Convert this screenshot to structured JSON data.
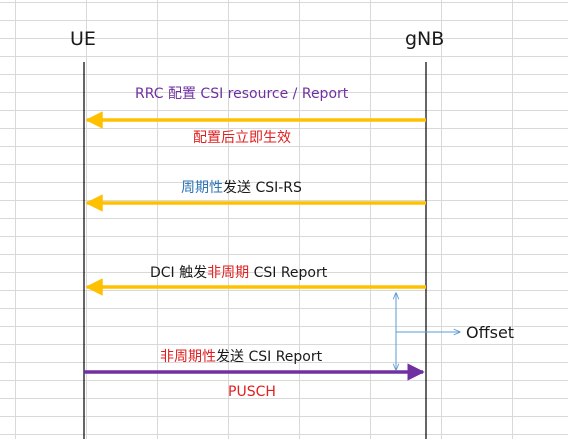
{
  "participants": {
    "left": "UE",
    "right": "gNB"
  },
  "colors": {
    "arrow_gold": "#FFC000",
    "arrow_purple": "#7030A0",
    "timing_blue": "#5B9BD5",
    "text_purple": "#7030A0",
    "text_red": "#E02020",
    "text_blue": "#2E75B6",
    "text_dark": "#1a1a1a",
    "grid_line": "#D9D9D9"
  },
  "messages": [
    {
      "label": "RRC 配置 CSI resource / Report",
      "direction": "gNB-to-UE",
      "arrow_color": "gold"
    },
    {
      "label_part1": "周期性",
      "label_part2": "发送 CSI-RS",
      "direction": "gNB-to-UE",
      "arrow_color": "gold"
    },
    {
      "label_part1": "DCI 触发",
      "label_part2": "非周期",
      "label_part3": " CSI Report",
      "direction": "gNB-to-UE",
      "arrow_color": "gold"
    },
    {
      "label_part1": "非周期性",
      "label_part2": "发送 CSI Report",
      "direction": "UE-to-gNB",
      "arrow_color": "purple"
    }
  ],
  "notes": {
    "config_effective": "配置后立即生效",
    "pusch": "PUSCH"
  },
  "timing": {
    "label": "Offset"
  }
}
